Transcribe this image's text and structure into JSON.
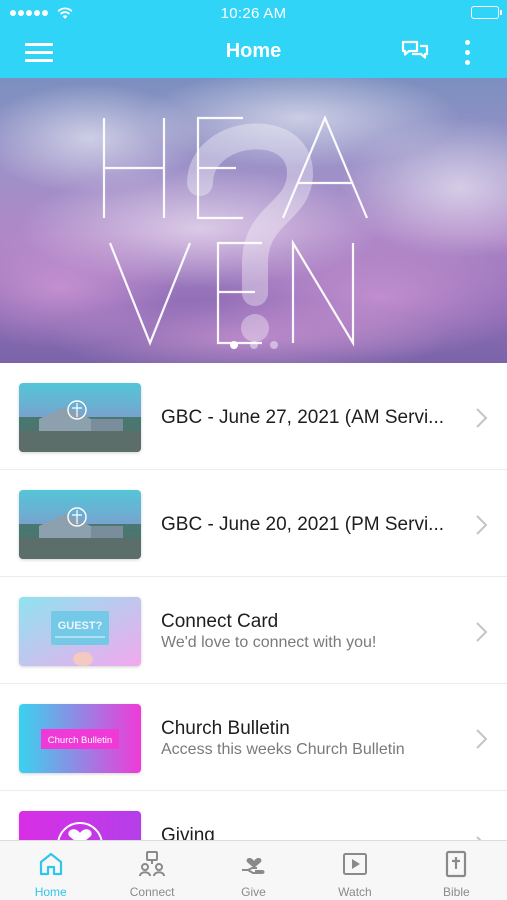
{
  "status_bar": {
    "time": "10:26 AM"
  },
  "nav": {
    "title": "Home"
  },
  "hero": {
    "slide_count": 3,
    "active_slide": 1,
    "artwork_text": "HEAVEN?"
  },
  "list": [
    {
      "title": "GBC - June 27, 2021 (AM Servi...",
      "subtitle": "",
      "thumb": "church-building"
    },
    {
      "title": "GBC - June 20, 2021 (PM Servi...",
      "subtitle": "",
      "thumb": "church-building"
    },
    {
      "title": "Connect Card",
      "subtitle": "We'd love to connect with you!",
      "thumb": "guest-card",
      "thumb_text": "GUEST?"
    },
    {
      "title": "Church Bulletin",
      "subtitle": "Access this weeks Church Bulletin",
      "thumb": "bulletin",
      "thumb_text": "Church Bulletin"
    },
    {
      "title": "Giving",
      "subtitle": "",
      "thumb": "giving-heart"
    }
  ],
  "tabs": [
    {
      "label": "Home",
      "icon": "home-icon",
      "active": true
    },
    {
      "label": "Connect",
      "icon": "connect-icon",
      "active": false
    },
    {
      "label": "Give",
      "icon": "give-icon",
      "active": false
    },
    {
      "label": "Watch",
      "icon": "watch-icon",
      "active": false
    },
    {
      "label": "Bible",
      "icon": "bible-icon",
      "active": false
    }
  ],
  "colors": {
    "header": "#2fd4f7",
    "active_tab": "#2fc6ee",
    "inactive_tab": "#8a8a8a"
  }
}
